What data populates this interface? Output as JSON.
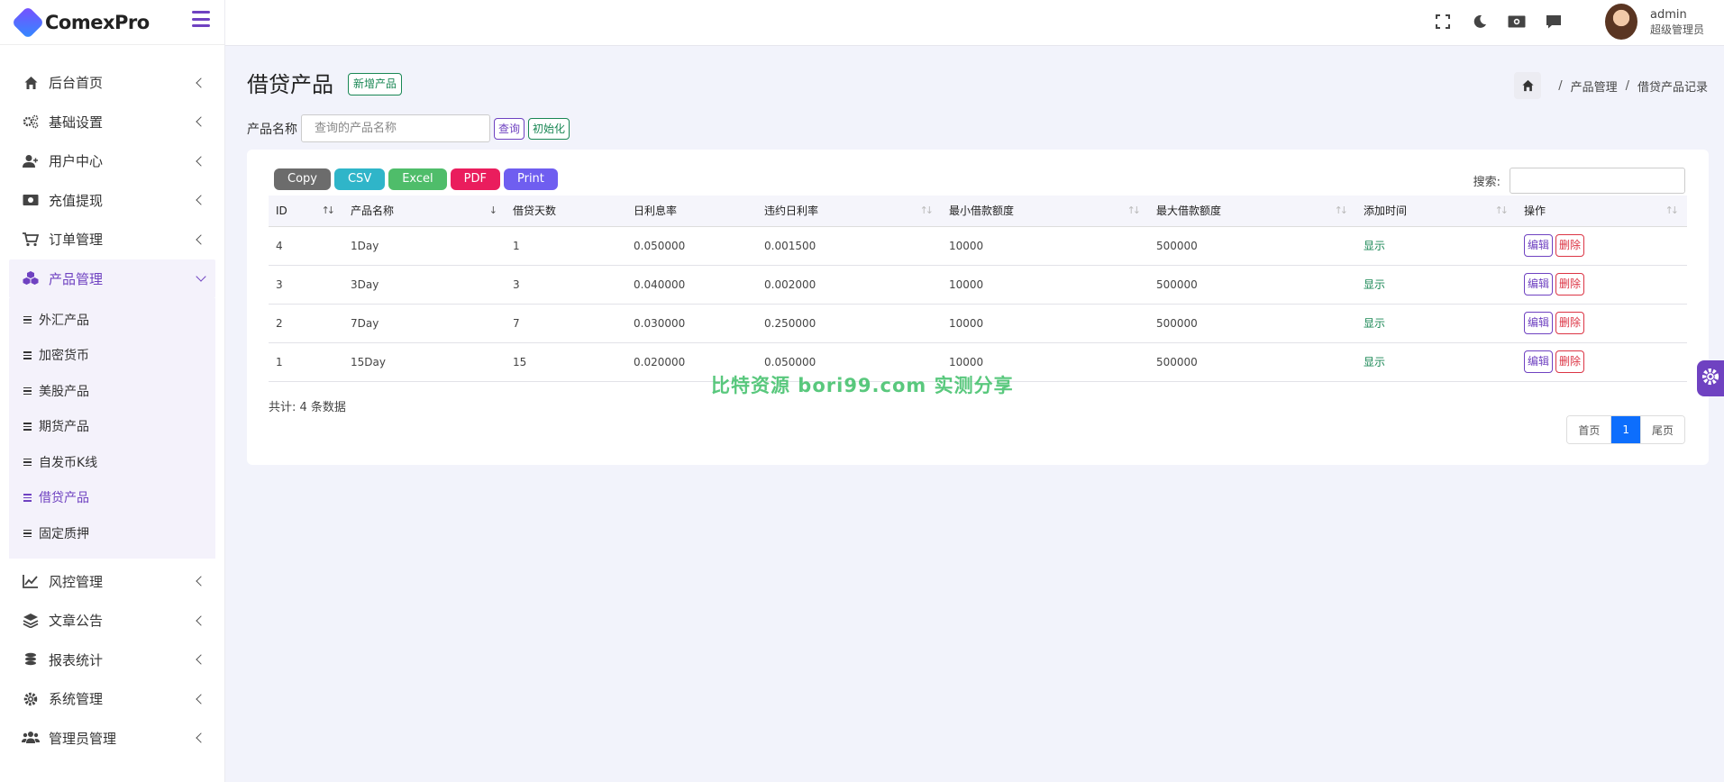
{
  "app": {
    "name": "ComexPro"
  },
  "sidebar": {
    "items": [
      {
        "label": "后台首页",
        "icon": "home-icon"
      },
      {
        "label": "基础设置",
        "icon": "cogs-icon"
      },
      {
        "label": "用户中心",
        "icon": "user-icon"
      },
      {
        "label": "充值提现",
        "icon": "money-icon"
      },
      {
        "label": "订单管理",
        "icon": "cart-icon"
      },
      {
        "label": "产品管理",
        "icon": "cubes-icon",
        "active": true
      },
      {
        "label": "风控管理",
        "icon": "chart-line-icon"
      },
      {
        "label": "文章公告",
        "icon": "layers-icon"
      },
      {
        "label": "报表统计",
        "icon": "coins-icon"
      },
      {
        "label": "系统管理",
        "icon": "gear-icon"
      },
      {
        "label": "管理员管理",
        "icon": "users-icon"
      }
    ],
    "subitems": [
      {
        "label": "外汇产品"
      },
      {
        "label": "加密货币"
      },
      {
        "label": "美股产品"
      },
      {
        "label": "期货产品"
      },
      {
        "label": "自发币K线"
      },
      {
        "label": "借贷产品",
        "active": true
      },
      {
        "label": "固定质押"
      }
    ]
  },
  "topbar": {
    "user_name": "admin",
    "user_role": "超级管理员"
  },
  "page": {
    "title": "借贷产品",
    "add_button": "新增产品",
    "breadcrumb": [
      "产品管理",
      "借贷产品记录"
    ]
  },
  "filter": {
    "label": "产品名称",
    "placeholder": "查询的产品名称",
    "query_button": "查询",
    "reset_button": "初始化"
  },
  "table": {
    "export_buttons": [
      {
        "label": "Copy",
        "color": "#6c6c6c"
      },
      {
        "label": "CSV",
        "color": "#2fb5c9"
      },
      {
        "label": "Excel",
        "color": "#4fbd6a"
      },
      {
        "label": "PDF",
        "color": "#ea1d5d"
      },
      {
        "label": "Print",
        "color": "#6f5ef0"
      }
    ],
    "search_label": "搜索:",
    "columns": [
      "ID",
      "产品名称",
      "借贷天数",
      "日利息率",
      "违约日利率",
      "最小借款额度",
      "最大借款额度",
      "添加时间",
      "操作"
    ],
    "rows": [
      {
        "id": "4",
        "name": "1Day",
        "days": "1",
        "rate": "0.050000",
        "penalty": "0.001500",
        "min": "10000",
        "max": "500000",
        "status": "显示"
      },
      {
        "id": "3",
        "name": "3Day",
        "days": "3",
        "rate": "0.040000",
        "penalty": "0.002000",
        "min": "10000",
        "max": "500000",
        "status": "显示"
      },
      {
        "id": "2",
        "name": "7Day",
        "days": "7",
        "rate": "0.030000",
        "penalty": "0.250000",
        "min": "10000",
        "max": "500000",
        "status": "显示"
      },
      {
        "id": "1",
        "name": "15Day",
        "days": "15",
        "rate": "0.020000",
        "penalty": "0.050000",
        "min": "10000",
        "max": "500000",
        "status": "显示"
      }
    ],
    "edit_label": "编辑",
    "delete_label": "删除",
    "total": "共计: 4 条数据",
    "pager": {
      "first": "首页",
      "current": "1",
      "last": "尾页"
    }
  },
  "watermark": "比特资源 bori99.com 实测分享",
  "colors": {
    "accent": "#6f42c1",
    "success": "#198754",
    "danger": "#dc3545",
    "primary": "#0d6efd"
  }
}
